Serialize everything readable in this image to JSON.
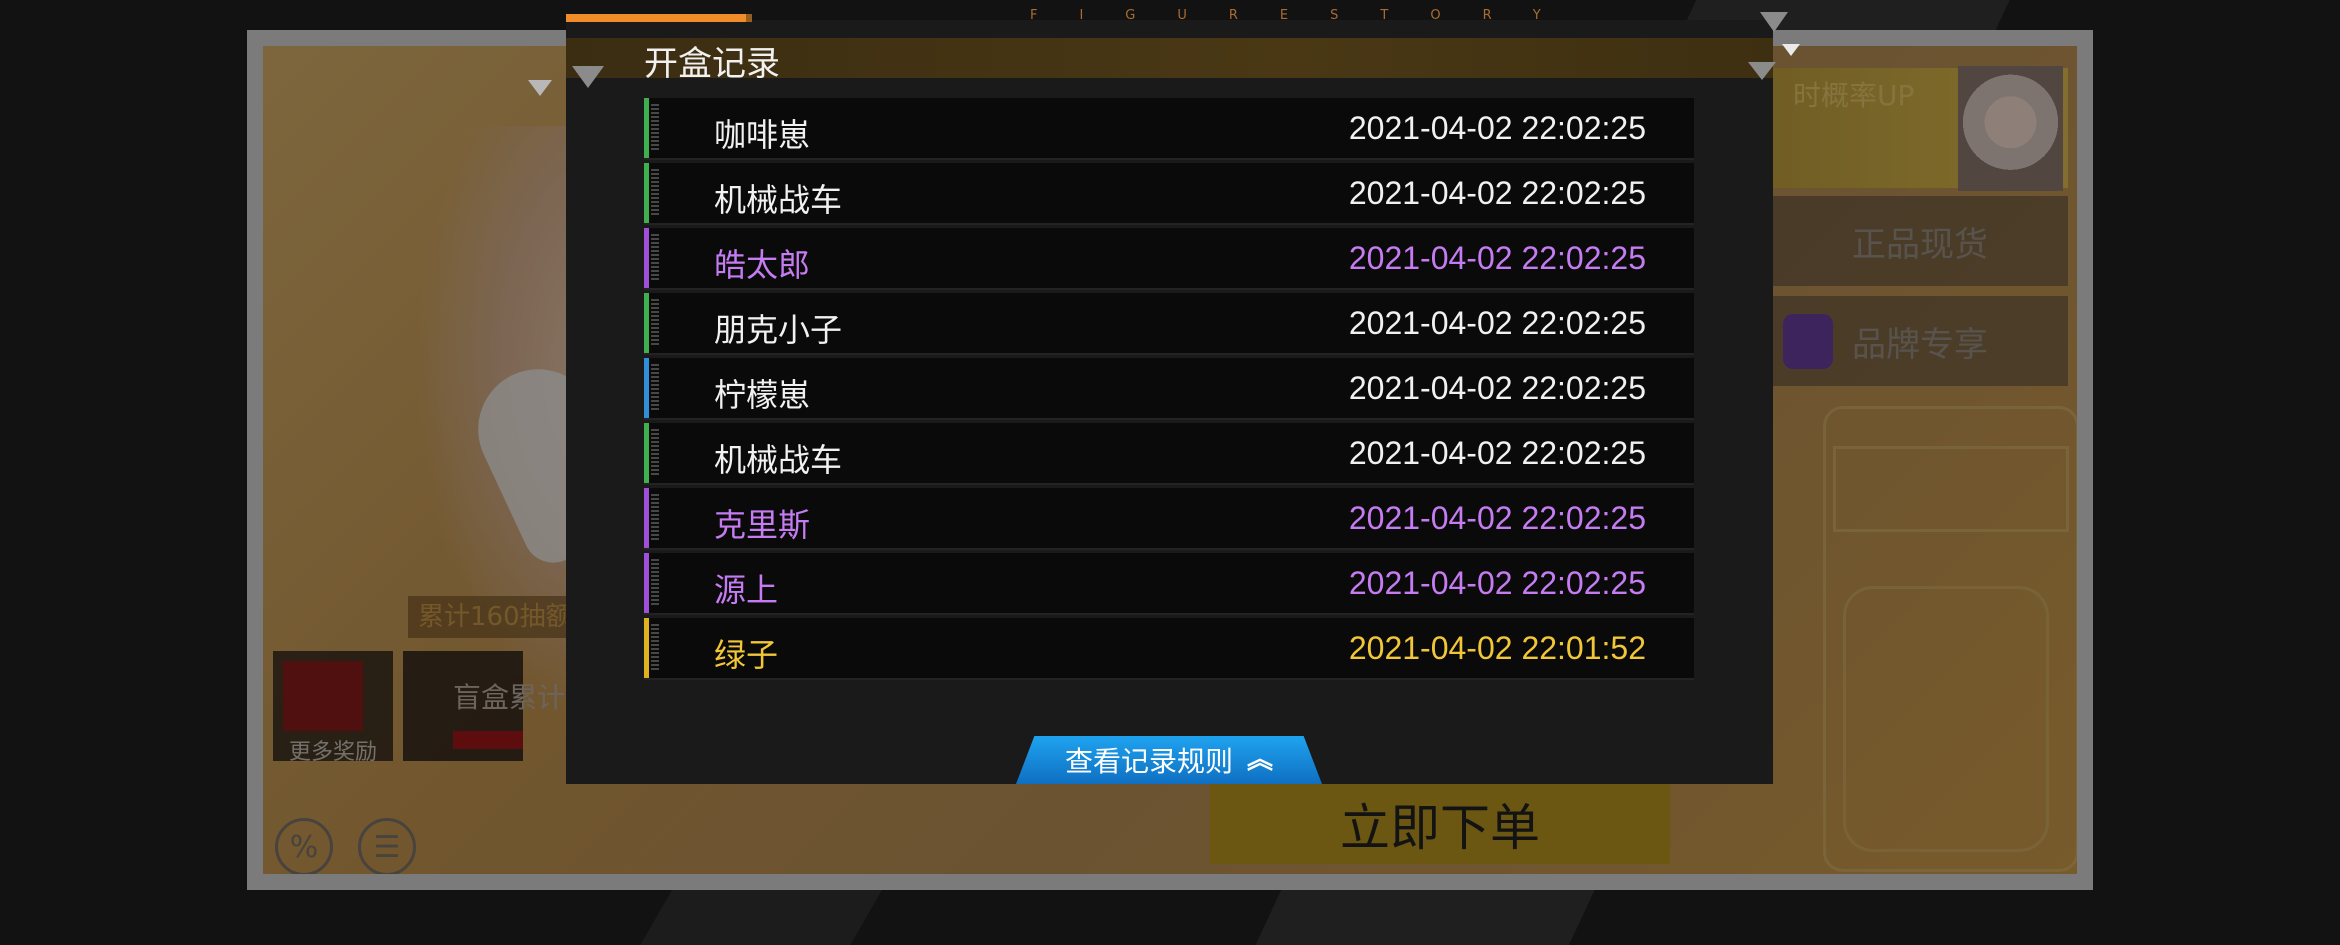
{
  "brand_strip": "FIGURESTORY",
  "modal": {
    "title": "开盒记录",
    "rules_button": "查看记录规则",
    "rules_icon": "double-chevron-up-icon"
  },
  "colors": {
    "green": "#3fb04f",
    "purple": "#a050d8",
    "blue": "#2f8fd8",
    "gold": "#e0b21f",
    "white_text": "#f1f1f1",
    "purple_text": "#c57cf2",
    "gold_text": "#f2c737"
  },
  "records": [
    {
      "name": "咖啡崽",
      "time": "2021-04-02 22:02:25",
      "rarity": "green"
    },
    {
      "name": "机械战车",
      "time": "2021-04-02 22:02:25",
      "rarity": "green"
    },
    {
      "name": "皓太郎",
      "time": "2021-04-02 22:02:25",
      "rarity": "purple"
    },
    {
      "name": "朋克小子",
      "time": "2021-04-02 22:02:25",
      "rarity": "green"
    },
    {
      "name": "柠檬崽",
      "time": "2021-04-02 22:02:25",
      "rarity": "blue"
    },
    {
      "name": "机械战车",
      "time": "2021-04-02 22:02:25",
      "rarity": "green"
    },
    {
      "name": "克里斯",
      "time": "2021-04-02 22:02:25",
      "rarity": "purple"
    },
    {
      "name": "源上",
      "time": "2021-04-02 22:02:25",
      "rarity": "purple"
    },
    {
      "name": "绿子",
      "time": "2021-04-02 22:01:52",
      "rarity": "gold"
    }
  ],
  "background": {
    "up_banner": "时概率UP",
    "btn_genuine": "正品现货",
    "btn_brand": "品牌专享",
    "reward_tag": "累计160抽额",
    "reward_more": "更多奖励",
    "reward_card_text": "盲盒累计",
    "discount_icon": "%",
    "notes_icon": "☰",
    "order_button": "立即下单"
  }
}
